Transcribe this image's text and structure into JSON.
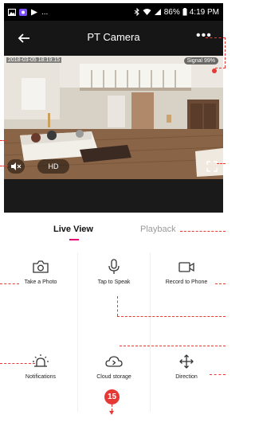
{
  "status_bar": {
    "left_icons": [
      "image-icon",
      "app-icon",
      "play-store-icon"
    ],
    "overflow": "...",
    "battery": "86%",
    "time": "4:19 PM"
  },
  "app_bar": {
    "title": "PT Camera",
    "more_label": "•••"
  },
  "video": {
    "timestamp": "2018-03-05 18:19:15",
    "signal": "Signal 99%",
    "quality_label": "HD"
  },
  "tabs": {
    "live": "Live View",
    "playback": "Playback"
  },
  "functions": {
    "take_photo": "Take a Photo",
    "tap_to_speak": "Tap to Speak",
    "record_to_phone": "Record to Phone",
    "notifications": "Notifications",
    "cloud_storage": "Cloud storage",
    "direction": "Direction"
  },
  "callout": {
    "number": "15"
  },
  "colors": {
    "accent": "#e5007a",
    "callout": "#e53935",
    "app_bar": "#161616"
  }
}
